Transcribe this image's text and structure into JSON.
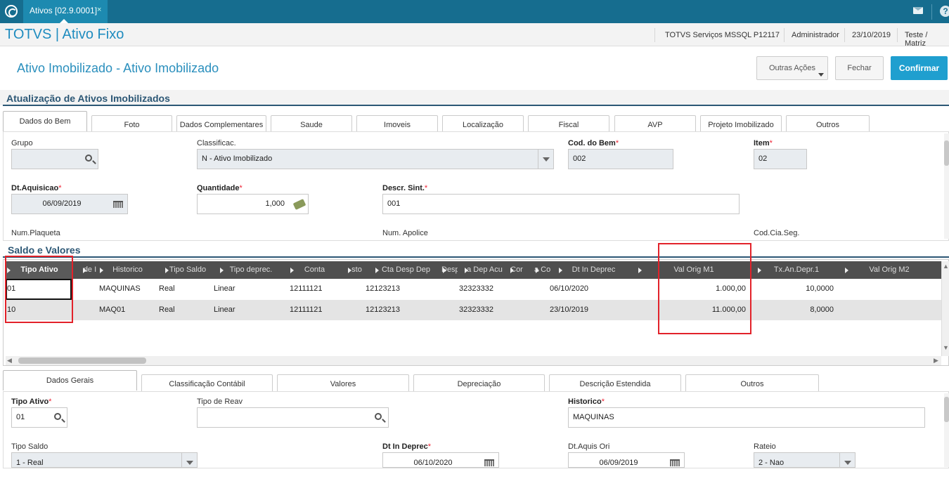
{
  "topbar": {
    "tab_label": "Ativos [02.9.0001]",
    "close_glyph": "×"
  },
  "header": {
    "app_title": "TOTVS | Ativo Fixo",
    "server": "TOTVS Serviços MSSQL P12117",
    "user": "Administrador",
    "date": "23/10/2019",
    "company": "Teste / Matriz"
  },
  "page": {
    "title": "Ativo Imobilizado - Ativo Imobilizado",
    "btn_outras": "Outras Ações",
    "btn_fechar": "Fechar",
    "btn_confirmar": "Confirmar",
    "section1": "Atualização de Ativos Imobilizados",
    "section2": "Saldo e Valores"
  },
  "tabs1": [
    "Dados do Bem",
    "Foto",
    "Dados Complementares",
    "Saude",
    "Imoveis",
    "Localização",
    "Fiscal",
    "AVP",
    "Projeto Imobilizado",
    "Outros"
  ],
  "form1": {
    "grupo_label": "Grupo",
    "grupo_value": "",
    "classif_label": "Classificac.",
    "classif_value": "N - Ativo Imobilizado",
    "codbem_label": "Cod. do Bem",
    "codbem_value": "002",
    "item_label": "Item",
    "item_value": "02",
    "dtaq_label": "Dt.Aquisicao",
    "dtaq_value": "06/09/2019",
    "qtd_label": "Quantidade",
    "qtd_value": "1,000",
    "descr_label": "Descr. Sint.",
    "descr_value": "001",
    "plaq_label": "Num.Plaqueta",
    "apol_label": "Num. Apolice",
    "cia_label": "Cod.Cia.Seg."
  },
  "grid": {
    "headers": [
      "Tipo Ativo",
      "de I",
      "Historico",
      "Tipo Saldo",
      "Tipo deprec.",
      "Conta",
      "sto",
      "Cta Desp Dep",
      "Desp",
      "a Dep Acu",
      "Cor",
      "a Co",
      "Dt In Deprec",
      "Val Orig M1",
      "Tx.An.Depr.1",
      "Val Orig M2"
    ],
    "rows": [
      {
        "tipo": "01",
        "hist": "MAQUINAS",
        "saldo": "Real",
        "deprec": "Linear",
        "conta": "12111121",
        "ctadesp": "12123213",
        "depacu": "32323332",
        "dtin": "06/10/2020",
        "val1": "1.000,00",
        "tx1": "10,0000"
      },
      {
        "tipo": "10",
        "hist": "MAQ01",
        "saldo": "Real",
        "deprec": "Linear",
        "conta": "12111121",
        "ctadesp": "12123213",
        "depacu": "32323332",
        "dtin": "23/10/2019",
        "val1": "11.000,00",
        "tx1": "8,0000"
      }
    ]
  },
  "tabs2": [
    "Dados Gerais",
    "Classificação Contábil",
    "Valores",
    "Depreciação",
    "Descrição Estendida",
    "Outros"
  ],
  "form2": {
    "tipoativo_label": "Tipo Ativo",
    "tipoativo_value": "01",
    "tiporeav_label": "Tipo de Reav",
    "tiporeav_value": "",
    "hist_label": "Historico",
    "hist_value": "MAQUINAS",
    "tiposaldo_label": "Tipo Saldo",
    "tiposaldo_value": "1 - Real",
    "dtin_label": "Dt In Deprec",
    "dtin_value": "06/10/2020",
    "dtaqori_label": "Dt.Aquis Ori",
    "dtaqori_value": "06/09/2019",
    "rateio_label": "Rateio",
    "rateio_value": "2 - Nao"
  },
  "required_mark": "*"
}
